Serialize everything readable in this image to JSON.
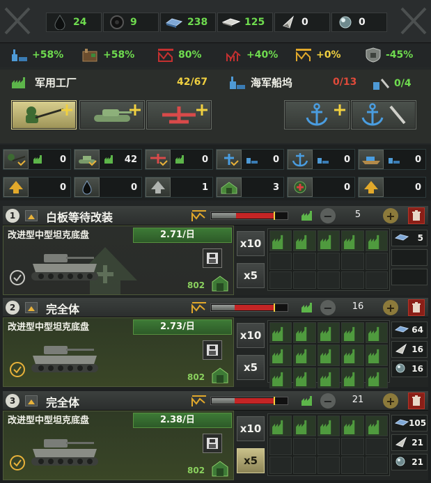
{
  "resources": [
    {
      "name": "oil",
      "icon": "oil-drop-icon",
      "value": "24"
    },
    {
      "name": "rubber",
      "icon": "rubber-tire-icon",
      "value": "9"
    },
    {
      "name": "steel",
      "icon": "steel-ingot-icon",
      "value": "238"
    },
    {
      "name": "aluminium",
      "icon": "aluminium-sheet-icon",
      "value": "125"
    },
    {
      "name": "tungsten",
      "icon": "tungsten-shard-icon",
      "value": "0"
    },
    {
      "name": "chromium",
      "icon": "chromium-orb-icon",
      "value": "0"
    }
  ],
  "modifiers": [
    {
      "icon": "dockyard-output-icon",
      "value": "+58%",
      "color": "#6fdc4f"
    },
    {
      "icon": "factory-output-icon",
      "value": "+58%",
      "color": "#6fdc4f"
    },
    {
      "icon": "efficiency-cap-icon",
      "value": "80%",
      "color": "#6fdc4f"
    },
    {
      "icon": "efficiency-growth-icon",
      "value": "+40%",
      "color": "#6fdc4f"
    },
    {
      "icon": "efficiency-retention-icon",
      "value": "+0%",
      "color": "#f0d040"
    },
    {
      "icon": "resource-gain-icon",
      "value": "-45%",
      "color": "#6fdc4f"
    }
  ],
  "buildings": {
    "military": {
      "title": "军用工厂",
      "used": "42/67",
      "color": "#f0d040"
    },
    "naval": {
      "title": "海军船坞",
      "used": "0/13",
      "used_color": "#e04a3a",
      "repair": "0/4",
      "repair_color": "#6fdc4f"
    }
  },
  "counters": {
    "row1": [
      "0",
      "42",
      "0",
      "0",
      "0",
      "0"
    ],
    "row2": [
      "0",
      "0",
      "1",
      "3",
      "0",
      "0"
    ]
  },
  "lines": [
    {
      "num": "1",
      "name": "白板等待改装",
      "qty": "5",
      "equipment": "改进型中型坦克底盘",
      "rate": "2.71/日",
      "factories": "802",
      "progress": 0.32,
      "mult_selected": "none",
      "materials": [
        {
          "icon": "steel-ingot-icon",
          "value": "5"
        }
      ]
    },
    {
      "num": "2",
      "name": "完全体",
      "qty": "16",
      "equipment": "改进型中型坦克底盘",
      "rate": "2.73/日",
      "factories": "802",
      "progress": 0.3,
      "mult_selected": "none",
      "materials": [
        {
          "icon": "steel-ingot-icon",
          "value": "64"
        },
        {
          "icon": "tungsten-shard-icon",
          "value": "16"
        },
        {
          "icon": "chromium-orb-icon",
          "value": "16"
        }
      ]
    },
    {
      "num": "3",
      "name": "完全体",
      "qty": "21",
      "equipment": "改进型中型坦克底盘",
      "rate": "2.38/日",
      "factories": "802",
      "progress": 0.3,
      "mult_selected": "x5",
      "materials": [
        {
          "icon": "steel-ingot-icon",
          "value": "105"
        },
        {
          "icon": "tungsten-shard-icon",
          "value": "21"
        },
        {
          "icon": "chromium-orb-icon",
          "value": "21"
        }
      ]
    }
  ],
  "labels": {
    "x10": "x10",
    "x5": "x5",
    "plus": "+",
    "minus": "−"
  }
}
